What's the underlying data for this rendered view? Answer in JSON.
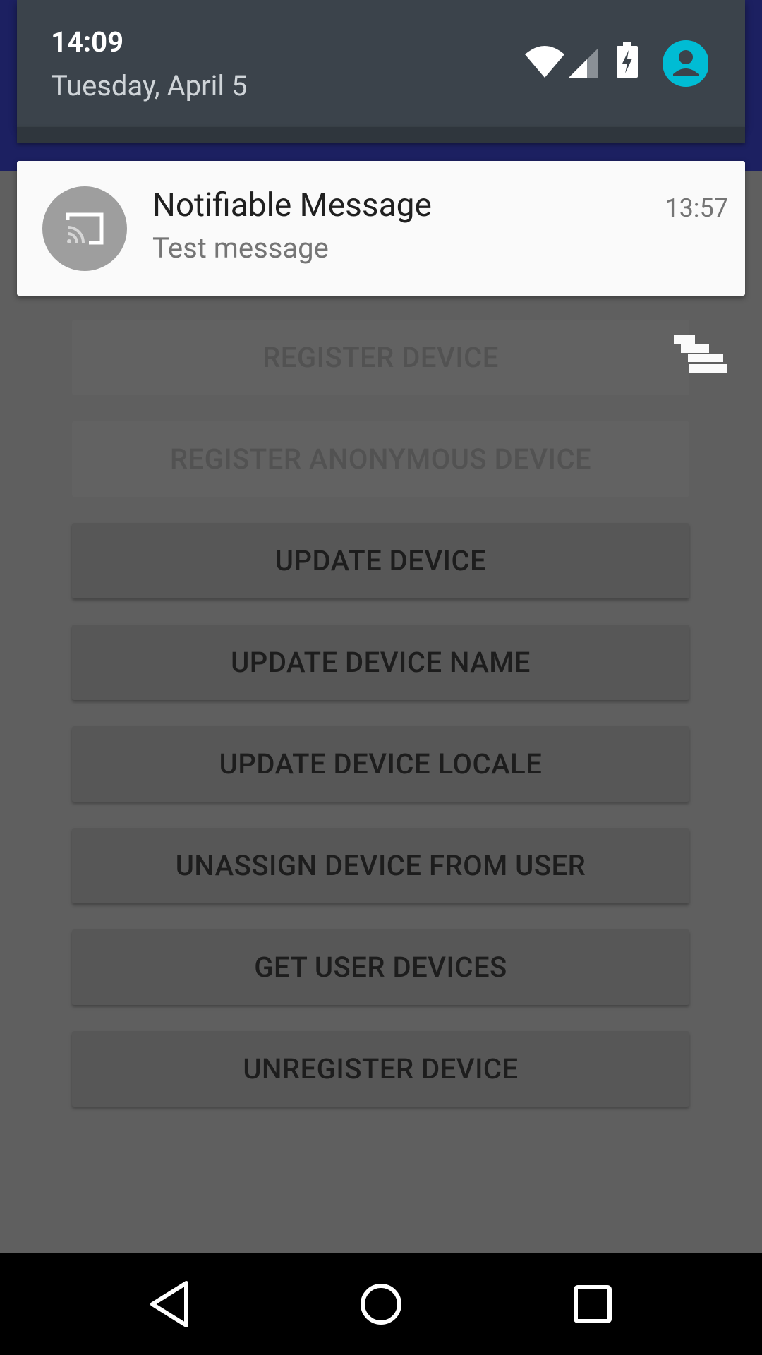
{
  "shade": {
    "time": "14:09",
    "date": "Tuesday, April 5",
    "icons": [
      "wifi-icon",
      "cell-signal-icon",
      "battery-charging-icon",
      "user-avatar-icon"
    ]
  },
  "notification": {
    "title": "Notifiable Message",
    "text": "Test message",
    "time": "13:57",
    "icon": "cast-icon"
  },
  "buttons": [
    {
      "label": "REGISTER DEVICE",
      "enabled": false
    },
    {
      "label": "REGISTER ANONYMOUS DEVICE",
      "enabled": false
    },
    {
      "label": "UPDATE DEVICE",
      "enabled": true
    },
    {
      "label": "UPDATE DEVICE NAME",
      "enabled": true
    },
    {
      "label": "UPDATE DEVICE LOCALE",
      "enabled": true
    },
    {
      "label": "UNASSIGN DEVICE FROM USER",
      "enabled": true
    },
    {
      "label": "GET USER DEVICES",
      "enabled": true
    },
    {
      "label": "UNREGISTER DEVICE",
      "enabled": true
    }
  ],
  "nav": [
    "back-icon",
    "home-icon",
    "recents-icon"
  ],
  "colors": {
    "app_bar": "#1c2061",
    "shade": "#3b434b",
    "avatar": "#00bcd4",
    "scrim": "#5e5e5e"
  }
}
